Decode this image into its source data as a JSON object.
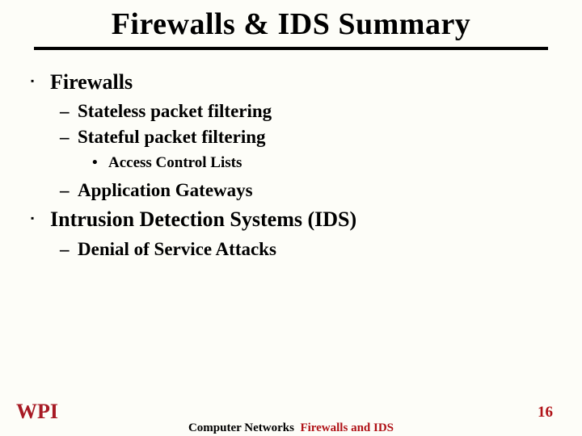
{
  "title": "Firewalls & IDS Summary",
  "bullets": {
    "b1": "Firewalls",
    "b1_1": "Stateless packet filtering",
    "b1_2": "Stateful packet filtering",
    "b1_2_1": "Access Control Lists",
    "b1_3": "Application Gateways",
    "b2": "Intrusion Detection Systems (IDS)",
    "b2_1": "Denial of Service Attacks"
  },
  "footer": {
    "course": "Computer Networks",
    "topic": "Firewalls and IDS",
    "page": "16"
  },
  "logo": {
    "text": "WPI",
    "color": "#a71a24"
  }
}
